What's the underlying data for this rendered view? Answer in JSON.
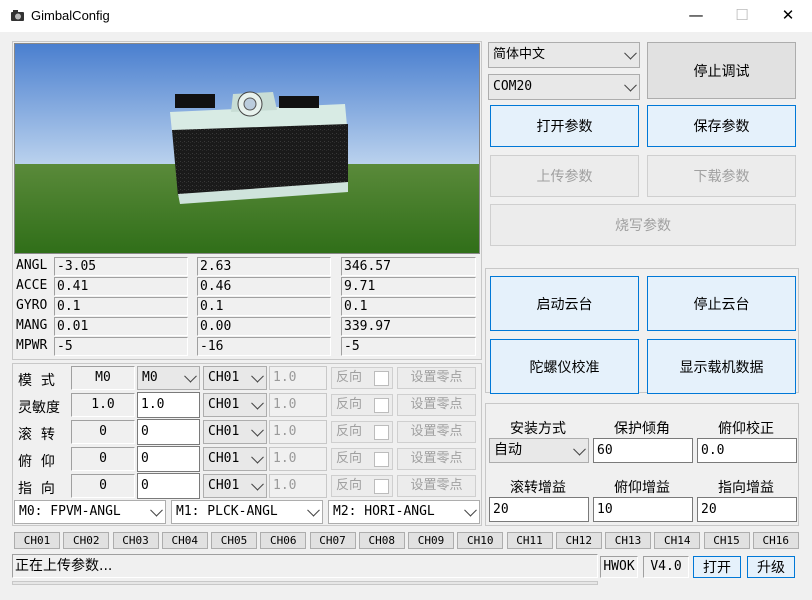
{
  "window": {
    "title": "GimbalConfig",
    "minimize_glyph": "—",
    "maximize_glyph": "☐",
    "close_glyph": "✕"
  },
  "top": {
    "language": "简体中文",
    "port": "COM20",
    "stop_debug": "停止调试",
    "open_params": "打开参数",
    "save_params": "保存参数",
    "upload_params": "上传参数",
    "download_params": "下载参数",
    "burn_params": "烧写参数"
  },
  "sensor": {
    "rows": [
      {
        "label": "ANGL",
        "v": [
          "-3.05",
          "2.63",
          "346.57"
        ]
      },
      {
        "label": "ACCE",
        "v": [
          "0.41",
          "0.46",
          "9.71"
        ]
      },
      {
        "label": "GYRO",
        "v": [
          "0.1",
          "0.1",
          "0.1"
        ]
      },
      {
        "label": "MANG",
        "v": [
          "0.01",
          "0.00",
          "339.97"
        ]
      },
      {
        "label": "MPWR",
        "v": [
          "-5",
          "-16",
          "-5"
        ]
      }
    ]
  },
  "controls": {
    "start_gimbal": "启动云台",
    "stop_gimbal": "停止云台",
    "gyro_calib": "陀螺仪校准",
    "show_carrier": "显示载机数据"
  },
  "channels": {
    "rows": [
      {
        "label": "模  式",
        "value": "M0",
        "input": "M0",
        "input_is_combo": true,
        "ch": "CH01",
        "num": "1.0",
        "reverse": "反向",
        "zero": "设置零点"
      },
      {
        "label": "灵敏度",
        "value": "1.0",
        "input": "1.0",
        "input_is_combo": false,
        "ch": "CH01",
        "num": "1.0",
        "reverse": "反向",
        "zero": "设置零点"
      },
      {
        "label": "滚  转",
        "value": "0",
        "input": "0",
        "input_is_combo": false,
        "ch": "CH01",
        "num": "1.0",
        "reverse": "反向",
        "zero": "设置零点"
      },
      {
        "label": "俯  仰",
        "value": "0",
        "input": "0",
        "input_is_combo": false,
        "ch": "CH01",
        "num": "1.0",
        "reverse": "反向",
        "zero": "设置零点"
      },
      {
        "label": "指  向",
        "value": "0",
        "input": "0",
        "input_is_combo": false,
        "ch": "CH01",
        "num": "1.0",
        "reverse": "反向",
        "zero": "设置零点"
      }
    ]
  },
  "modes": [
    "M0: FPVM-ANGL",
    "M1: PLCK-ANGL",
    "M2: HORI-ANGL"
  ],
  "settings": {
    "mount_label": "安装方式",
    "mount_value": "自动",
    "protect_label": "保护倾角",
    "protect_value": "60",
    "pitch_cal_label": "俯仰校正",
    "pitch_cal_value": "0.0",
    "roll_gain_label": "滚转增益",
    "roll_gain_value": "20",
    "pitch_gain_label": "俯仰增益",
    "pitch_gain_value": "10",
    "yaw_gain_label": "指向增益",
    "yaw_gain_value": "20"
  },
  "ch_buttons": [
    "CH01",
    "CH02",
    "CH03",
    "CH04",
    "CH05",
    "CH06",
    "CH07",
    "CH08",
    "CH09",
    "CH10",
    "CH11",
    "CH12",
    "CH13",
    "CH14",
    "CH15",
    "CH16"
  ],
  "status": {
    "message": "正在上传参数...",
    "device": "HWOK",
    "version": "V4.0",
    "open": "打开",
    "upgrade": "升级"
  },
  "colors": {
    "accent": "#0078d7",
    "sky": "#5f8fd0",
    "ground": "#3c7a22"
  }
}
